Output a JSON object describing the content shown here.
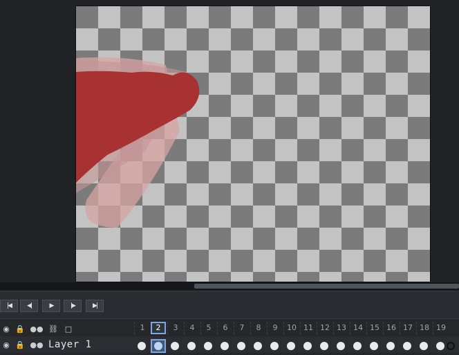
{
  "transport": {
    "buttons": [
      {
        "name": "first-frame-button",
        "icon": "first-frame-icon",
        "glyph": "|◀"
      },
      {
        "name": "prev-frame-button",
        "icon": "prev-frame-icon",
        "glyph": "◀|"
      },
      {
        "name": "play-button",
        "icon": "play-icon",
        "glyph": "▶"
      },
      {
        "name": "next-frame-button",
        "icon": "next-frame-icon",
        "glyph": "|▶"
      },
      {
        "name": "last-frame-button",
        "icon": "last-frame-icon",
        "glyph": "▶|"
      }
    ]
  },
  "timeline": {
    "header_icons": [
      "eye-icon",
      "lock-icon",
      "onion-skin-icon",
      "link-cels-icon",
      "new-frame-icon"
    ],
    "frames": [
      "1",
      "2",
      "3",
      "4",
      "5",
      "6",
      "7",
      "8",
      "9",
      "10",
      "11",
      "12",
      "13",
      "14",
      "15",
      "16",
      "17",
      "18",
      "19"
    ],
    "current_frame": "2",
    "layer": {
      "name": "Layer 1"
    }
  },
  "colors": {
    "paint_red": "#a83232",
    "selection_blue": "#7aa8e8"
  }
}
